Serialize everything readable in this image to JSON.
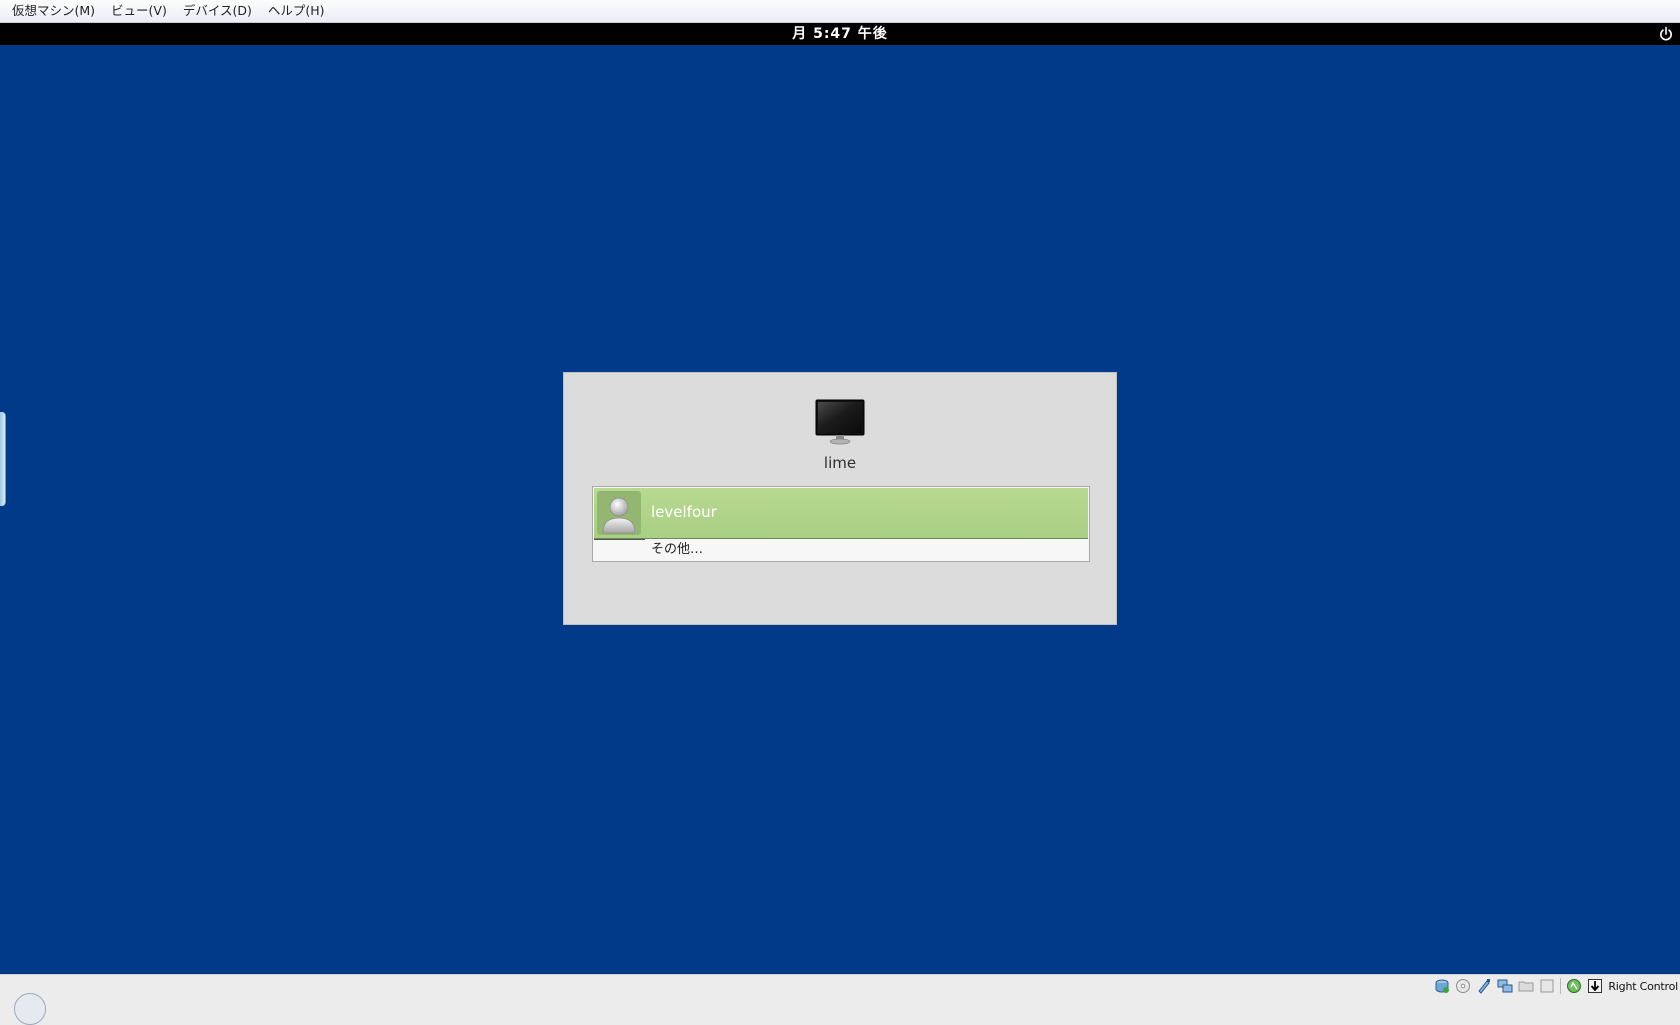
{
  "vm_menubar": {
    "items": [
      {
        "label": "仮想マシン(M)"
      },
      {
        "label": "ビュー(V)"
      },
      {
        "label": "デバイス(D)"
      },
      {
        "label": "ヘルプ(H)"
      }
    ]
  },
  "guest": {
    "background_color": "#013a88",
    "top_panel": {
      "clock": "月 5:47 午後",
      "power_icon": "power-icon"
    },
    "login": {
      "host_icon": "computer-monitor-icon",
      "hostname": "lime",
      "users": [
        {
          "name": "levelfour",
          "avatar": "user-avatar-icon",
          "selected": true,
          "selected_color": "#b3d68d"
        }
      ],
      "other_label": "その他…"
    }
  },
  "vm_statusbar": {
    "icons": [
      "hard-disk-icon",
      "optical-drive-icon",
      "usb-icon",
      "network-icon",
      "shared-folder-icon",
      "display-icon",
      "virtualization-icon",
      "mouse-integration-icon"
    ],
    "host_key": "Right Control"
  }
}
